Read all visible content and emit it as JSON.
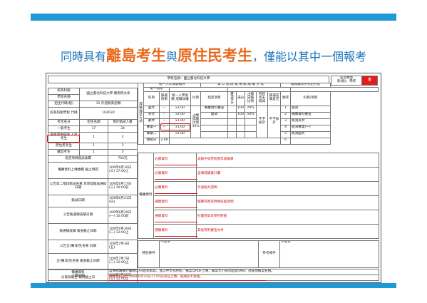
{
  "slide": {
    "headline": {
      "part1": "同時具有",
      "part2": "離島考生",
      "part3": "與",
      "part4": "原住民考生",
      "part5": "，僅能以其中一個報考"
    },
    "colors": {
      "bar": "#1e9bd7",
      "headline_blue": "#1a72b8",
      "headline_orange": "#e8691e",
      "annotation_red": "#d01616"
    }
  },
  "doc": {
    "title": "學校名稱：國立臺北科技大學",
    "corner_label": "是否願意",
    "corner_label2": "系(組)、學校",
    "corner_value": "否",
    "left": [
      [
        "校系科組",
        "國立臺北科技大學 應用英文系"
      ],
      [
        "學程名稱",
        ""
      ],
      [
        "招生代碼(組)",
        "15 外語群英語類"
      ],
      [
        "校系科組學程\n代碼",
        "104030"
      ],
      [
        "考生身分",
        "招生名額",
        "預計甄試人數"
      ],
      [
        "一般考生",
        "17",
        "34"
      ],
      [
        "低收或中低收\n入戶考生",
        "1",
        "3"
      ],
      [
        "原住民考生",
        "1",
        "3"
      ],
      [
        "離島考生",
        "1",
        "3"
      ],
      [
        "指定項目甄試收費",
        "750元"
      ],
      [
        "備審資料上傳繳費\n截止時間",
        "109年6月10日\n(三)\n17:00止"
      ],
      [
        "公告第二階段甄試名單\n及寄發甄試通知日期",
        "109年6月17日\n(三)\n10:00前"
      ],
      [
        "甄試日期",
        "109年6月21日\n(日)"
      ],
      [
        "公告甄選總成績日期",
        "109年6月29日\n(一)\n10:00前"
      ],
      [
        "甄選總成績\n複查截止日期",
        "109年6月30日\n(二)\n12:00止"
      ],
      [
        "公告正(備)取生名單\n日期",
        "109年7月3日\n(五)"
      ],
      [
        "正(備)取生名單\n複查截止日期",
        "109年7月7日\n(二)\n12:00止"
      ],
      [
        "分發錄取生\n報到截止日",
        "109年7月15日\n(三)\n12:00止"
      ]
    ],
    "mid": {
      "header_stage1": "統一入學測驗總分",
      "header_stage1b": "第一階段",
      "header_stage2": "第  二  階  段  甄  選  總  成  績  方  式",
      "header_stage3": "總成績同分參酌方式",
      "side_label": "成績採計方式",
      "col_subject": "科目",
      "col_rate": "篩選倍率",
      "col_weight": "統一入學測驗\n成績加權",
      "col_ratio": "比例",
      "col_item": "指定項目",
      "col_min": "最低得分",
      "col_full": "滿分",
      "col_pct": "占總成績比例",
      "col_fail": "有校考未缺減",
      "col_pass": "篩選成績是否",
      "col_order": "順序",
      "col_cmp": "科目/項目",
      "rows": [
        [
          "國文",
          "--",
          "x1.00"
        ],
        [
          "英文",
          "--",
          "x1.00"
        ],
        [
          "數學",
          "--",
          "x1.00"
        ],
        [
          "專業一",
          "--",
          "x1.00"
        ],
        [
          "專業二",
          "--",
          "x1.00"
        ]
      ],
      "total_label": "總級分",
      "total_rate": "2.00",
      "item_review": "備審資料審查",
      "item_interview": "面試",
      "review_full": "100",
      "review_pct": "20%",
      "interview_full": "100",
      "interview_pct": "50%",
      "weighted_note": "占總成績比例",
      "weighted_pct": "30%",
      "no_test": "不予採計",
      "compare": [
        [
          "1",
          "面試"
        ],
        [
          "2",
          "備審資料審查"
        ],
        [
          "3",
          "統測英文"
        ],
        [
          "4",
          "統測專業(一)"
        ],
        [
          "5",
          "統測國文"
        ],
        [
          "6",
          ""
        ]
      ]
    },
    "docs": {
      "group_label": "備審資料",
      "items": [
        {
          "tag": "必繳資料",
          "text": "高級中等學校歷年成績單"
        },
        {
          "tag": "必繳資料",
          "text": "自傳或讀書計畫"
        },
        {
          "tag": "必繳資料",
          "text": "外語能力證明"
        },
        {
          "tag": "選繳資料",
          "text": "競賽得獎或特殊技能證明"
        },
        {
          "tag": "選繳資料",
          "text": "社團參與及學校幹部"
        },
        {
          "tag": "選繳資料",
          "text": "其他有利審查文件"
        }
      ],
      "special_label": "特別條件",
      "special_value": "不需求",
      "notes_label": "參考條件",
      "notes_value": "不需求"
    },
    "footer": {
      "label1": "備審資料",
      "label2": "上傳說明",
      "text1": "自傳或讀書計畫請以A4直式撰寫，並以中文為原則，檔案以PDF上傳，檔案大小請勿超過5MB；須註明檔案名稱。",
      "text2": "備審資料須於109年6月10日17:00前完成上傳，逾期恕不受理。"
    }
  }
}
